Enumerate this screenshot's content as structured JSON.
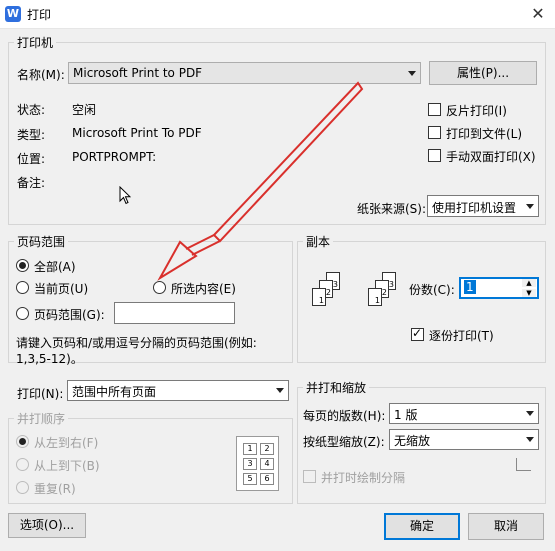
{
  "window": {
    "title": "打印",
    "app_icon": "W"
  },
  "printer": {
    "group_label": "打印机",
    "name_label": "名称(M):",
    "name_value": "Microsoft Print to PDF",
    "properties_button": "属性(P)...",
    "status_label": "状态:",
    "status_value": "空闲",
    "type_label": "类型:",
    "type_value": "Microsoft Print To PDF",
    "where_label": "位置:",
    "where_value": "PORTPROMPT:",
    "comment_label": "备注:",
    "options": [
      "反片打印(I)",
      "打印到文件(L)",
      "手动双面打印(X)"
    ],
    "paper_source_label": "纸张来源(S):",
    "paper_source_value": "使用打印机设置"
  },
  "page_range": {
    "group_label": "页码范围",
    "all": "全部(A)",
    "current": "当前页(U)",
    "selection": "所选内容(E)",
    "pages": "页码范围(G):",
    "pages_value": "",
    "hint_line1": "请键入页码和/或用逗号分隔的页码范围(例如:",
    "hint_line2": "1,3,5-12)。"
  },
  "copies": {
    "group_label": "副本",
    "count_label": "份数(C):",
    "count_value": "1",
    "collate_label": "逐份打印(T)",
    "collate_checked": true
  },
  "print_what": {
    "label": "打印(N):",
    "value": "范围中所有页面"
  },
  "order": {
    "group_label": "并打顺序",
    "options": [
      "从左到右(F)",
      "从上到下(B)",
      "重复(R)"
    ],
    "preview_numbers": [
      "1",
      "2",
      "3",
      "4",
      "5",
      "6"
    ]
  },
  "zoom": {
    "group_label": "并打和缩放",
    "pages_per_sheet_label": "每页的版数(H):",
    "pages_per_sheet_value": "1 版",
    "scale_label": "按纸型缩放(Z):",
    "scale_value": "无缩放",
    "draw_borders_label": "并打时绘制分隔"
  },
  "footer": {
    "options_button": "选项(O)...",
    "ok_button": "确定",
    "cancel_button": "取消"
  },
  "colors": {
    "annotation_arrow": "#d9302c",
    "focus_border": "#0078d7"
  }
}
